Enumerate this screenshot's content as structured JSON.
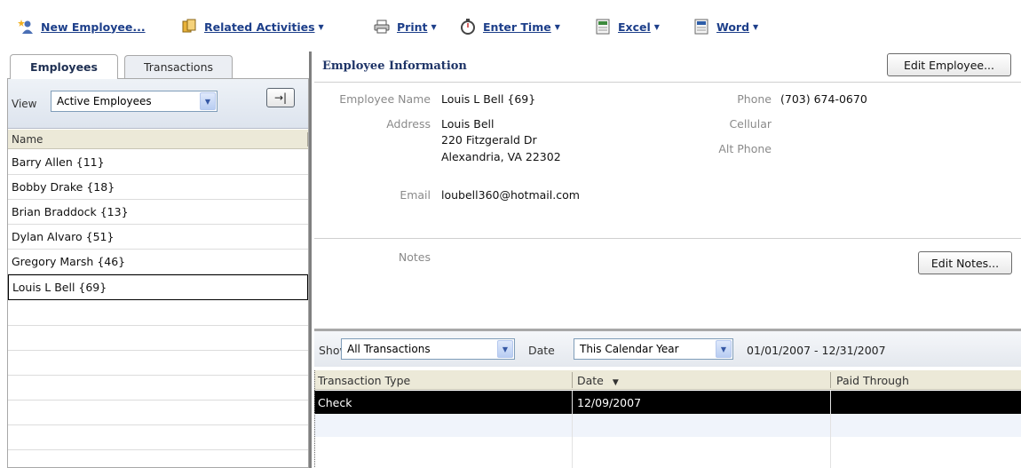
{
  "toolbar": {
    "new_employee": "New Employee...",
    "related_activities": "Related Activities",
    "print": "Print",
    "enter_time": "Enter Time",
    "excel": "Excel",
    "word": "Word"
  },
  "tabs": {
    "employees": "Employees",
    "transactions": "Transactions"
  },
  "view": {
    "label": "View",
    "selected": "Active Employees"
  },
  "list": {
    "header": "Name",
    "items": [
      "Barry Allen {11}",
      "Bobby Drake {18}",
      "Brian Braddock {13}",
      "Dylan Alvaro {51}",
      "Gregory Marsh {46}",
      "Louis L Bell {69}"
    ]
  },
  "info": {
    "title": "Employee Information",
    "edit_employee": "Edit Employee...",
    "labels": {
      "name": "Employee Name",
      "address": "Address",
      "email": "Email",
      "notes": "Notes",
      "phone": "Phone",
      "cellular": "Cellular",
      "alt_phone": "Alt Phone"
    },
    "name": "Louis L Bell {69}",
    "address_line1": "Louis Bell",
    "address_line2": "220 Fitzgerald Dr",
    "address_line3": "Alexandria, VA 22302",
    "email": "loubell360@hotmail.com",
    "phone": "(703) 674-0670",
    "edit_notes": "Edit Notes..."
  },
  "transactions": {
    "show_label": "Show",
    "show_selected": "All Transactions",
    "date_label": "Date",
    "date_selected": "This Calendar Year",
    "range": "01/01/2007 - 12/31/2007",
    "columns": [
      "Transaction Type",
      "Date",
      "Paid Through"
    ],
    "rows": [
      {
        "type": "Check",
        "date": "12/09/2007",
        "paid_through": ""
      }
    ]
  },
  "colors": {
    "toolbar_text": "#1d3f8a",
    "title_text": "#1e3467",
    "selected_row": "#000000"
  }
}
